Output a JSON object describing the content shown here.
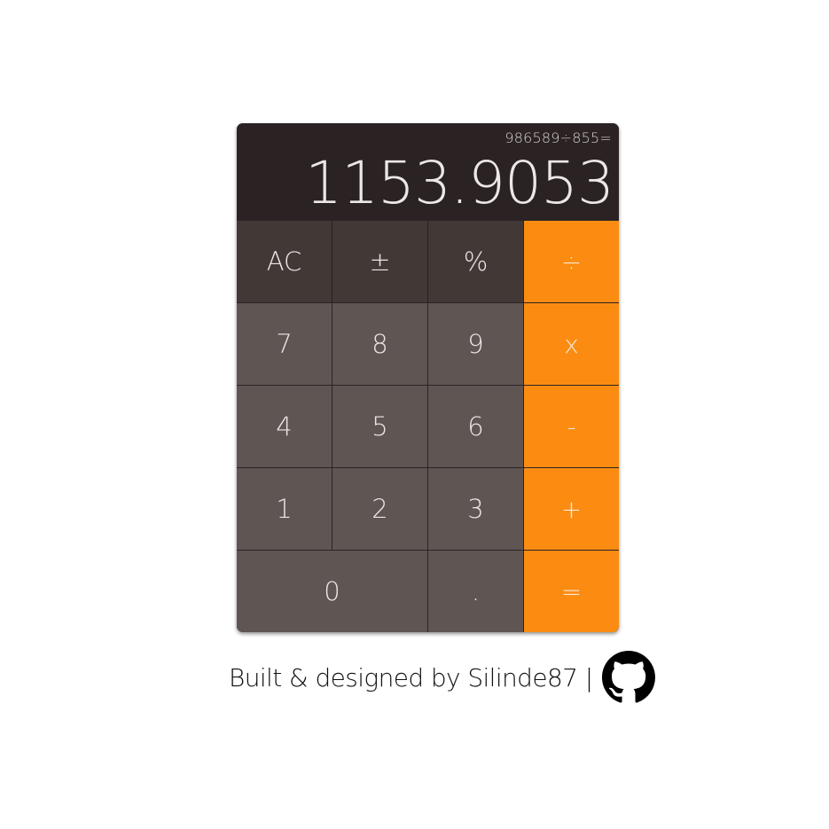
{
  "calculator": {
    "expression": "986589÷855=",
    "result": "1153.9053",
    "keys": {
      "clear": "AC",
      "sign": "±",
      "percent": "%",
      "divide": "÷",
      "seven": "7",
      "eight": "8",
      "nine": "9",
      "multiply": "x",
      "four": "4",
      "five": "5",
      "six": "6",
      "subtract": "-",
      "one": "1",
      "two": "2",
      "three": "3",
      "add": "+",
      "zero": "0",
      "decimal": ".",
      "equals": "="
    }
  },
  "footer": {
    "text": "Built & designed by Silinde87 |",
    "icon": "github-icon"
  },
  "colors": {
    "display_background": "#2b2224",
    "function_key": "#423836",
    "number_key": "#5f5654",
    "operator_key": "#fb8c11",
    "key_text": "#ebe6e6"
  }
}
